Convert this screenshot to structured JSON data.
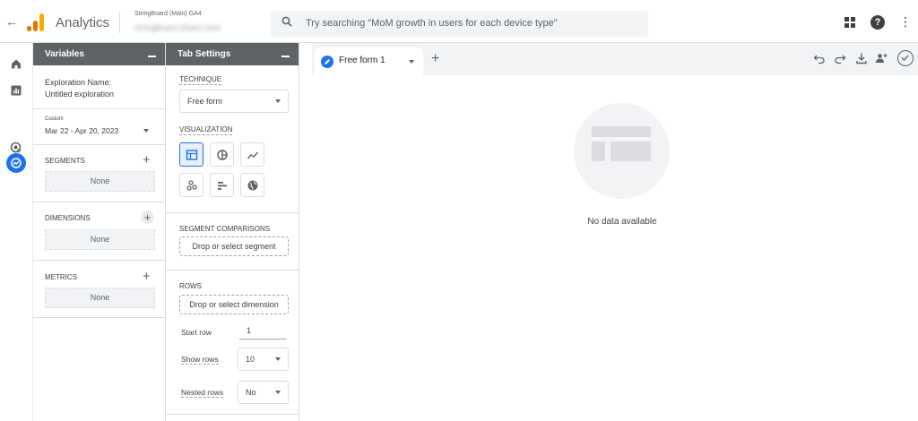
{
  "topbar": {
    "app_title": "Analytics",
    "account_label": "StringBoard (Main) GA4",
    "property_label": "StringBoard (Main) GA4",
    "search_placeholder": "Try searching \"MoM growth in users for each device type\""
  },
  "variables_panel": {
    "title": "Variables",
    "exploration_name_label": "Exploration Name:",
    "exploration_name_value": "Untitled exploration",
    "date_tag": "Custom",
    "date_range": "Mar 22 - Apr 20, 2023",
    "segments_label": "SEGMENTS",
    "segments_value": "None",
    "dimensions_label": "DIMENSIONS",
    "dimensions_value": "None",
    "metrics_label": "METRICS",
    "metrics_value": "None"
  },
  "tab_settings": {
    "title": "Tab Settings",
    "technique_label": "TECHNIQUE",
    "technique_value": "Free form",
    "visualization_label": "VISUALIZATION",
    "visualizations": [
      "table-icon",
      "donut-chart-icon",
      "line-chart-icon",
      "scatter-plot-icon",
      "bar-chart-icon",
      "geo-map-icon"
    ],
    "segment_comparisons_label": "SEGMENT COMPARISONS",
    "segment_dropzone": "Drop or select segment",
    "rows_label": "ROWS",
    "rows_dropzone": "Drop or select dimension",
    "start_row_label": "Start row",
    "start_row_value": "1",
    "show_rows_label": "Show rows",
    "show_rows_value": "10",
    "nested_rows_label": "Nested rows",
    "nested_rows_value": "No"
  },
  "canvas": {
    "tab_label": "Free form 1",
    "empty_message": "No data available"
  },
  "colors": {
    "accent": "#1a73e8",
    "panel_header": "#5f6368",
    "logo_orange": "#f9ab00"
  }
}
